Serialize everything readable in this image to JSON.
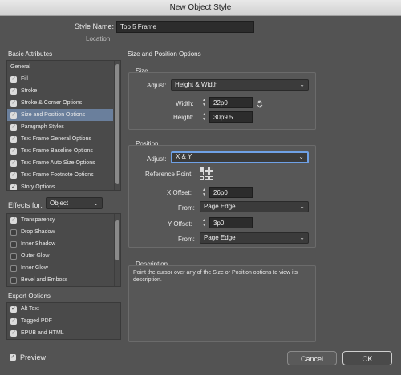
{
  "window": {
    "title": "New Object Style"
  },
  "header": {
    "style_name_label": "Style Name:",
    "style_name_value": "Top 5 Frame",
    "location_label": "Location:"
  },
  "basic_attributes": {
    "title": "Basic Attributes",
    "items": [
      {
        "label": "General",
        "checkbox": false,
        "checked": false,
        "selected": false
      },
      {
        "label": "Fill",
        "checkbox": true,
        "checked": true,
        "selected": false
      },
      {
        "label": "Stroke",
        "checkbox": true,
        "checked": true,
        "selected": false
      },
      {
        "label": "Stroke & Corner Options",
        "checkbox": true,
        "checked": true,
        "selected": false
      },
      {
        "label": "Size and Position Options",
        "checkbox": true,
        "checked": true,
        "selected": true
      },
      {
        "label": "Paragraph Styles",
        "checkbox": true,
        "checked": true,
        "selected": false
      },
      {
        "label": "Text Frame General Options",
        "checkbox": true,
        "checked": true,
        "selected": false
      },
      {
        "label": "Text Frame Baseline Options",
        "checkbox": true,
        "checked": true,
        "selected": false
      },
      {
        "label": "Text Frame Auto Size Options",
        "checkbox": true,
        "checked": true,
        "selected": false
      },
      {
        "label": "Text Frame Footnote Options",
        "checkbox": true,
        "checked": true,
        "selected": false
      },
      {
        "label": "Story Options",
        "checkbox": true,
        "checked": true,
        "selected": false
      }
    ]
  },
  "effects": {
    "label": "Effects for:",
    "target": "Object",
    "items": [
      {
        "label": "Transparency",
        "checked": true
      },
      {
        "label": "Drop Shadow",
        "checked": false
      },
      {
        "label": "Inner Shadow",
        "checked": false
      },
      {
        "label": "Outer Glow",
        "checked": false
      },
      {
        "label": "Inner Glow",
        "checked": false
      },
      {
        "label": "Bevel and Emboss",
        "checked": false
      }
    ]
  },
  "export_options": {
    "title": "Export Options",
    "items": [
      {
        "label": "Alt Text",
        "checked": true
      },
      {
        "label": "Tagged PDF",
        "checked": true
      },
      {
        "label": "EPUB and HTML",
        "checked": true
      }
    ]
  },
  "panel": {
    "title": "Size and Position Options",
    "size": {
      "title": "Size",
      "adjust_label": "Adjust:",
      "adjust_value": "Height & Width",
      "width_label": "Width:",
      "width_value": "22p0",
      "height_label": "Height:",
      "height_value": "30p9.5"
    },
    "position": {
      "title": "Position",
      "adjust_label": "Adjust:",
      "adjust_value": "X & Y",
      "reference_point_label": "Reference Point:",
      "x_offset_label": "X Offset:",
      "x_offset_value": "26p0",
      "x_from_label": "From:",
      "x_from_value": "Page Edge",
      "y_offset_label": "Y Offset:",
      "y_offset_value": "3p0",
      "y_from_label": "From:",
      "y_from_value": "Page Edge"
    },
    "description": {
      "title": "Description",
      "text": "Point the cursor over any of the Size or Position options to view its description."
    }
  },
  "footer": {
    "preview_label": "Preview",
    "preview_checked": true,
    "cancel_label": "Cancel",
    "ok_label": "OK"
  }
}
